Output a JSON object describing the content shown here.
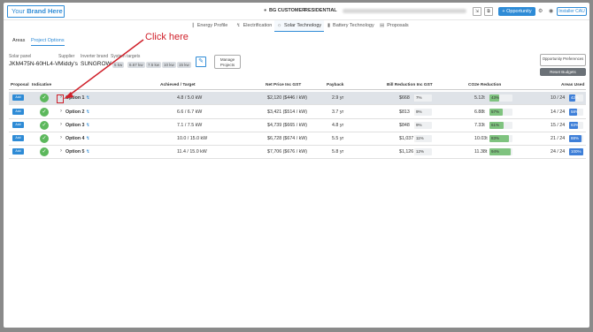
{
  "header": {
    "brand_prefix": "Your ",
    "brand_bold": "Brand Here",
    "user_label": "BG CUSTOMER",
    "mode_label": "RESIDENTIAL",
    "opportunity_button": "+ Opportunity",
    "installer_button": "Installer CAU"
  },
  "main_tabs": [
    {
      "label": "Energy Profile",
      "icon": "chart-icon"
    },
    {
      "label": "Electrification",
      "icon": "bolt-icon"
    },
    {
      "label": "Solar Technology",
      "icon": "sun-icon"
    },
    {
      "label": "Battery Technology",
      "icon": "battery-icon"
    },
    {
      "label": "Proposals",
      "icon": "document-icon"
    }
  ],
  "sub_tabs": [
    {
      "label": "Areas"
    },
    {
      "label": "Project Options"
    }
  ],
  "config": {
    "solar_panel_label": "Solar panel",
    "solar_panel_value": "JKM475N-60HL4-V",
    "supplier_label": "Supplier",
    "supplier_value": "Middy's",
    "inverter_label": "Inverter brand",
    "inverter_value": "SUNGROW",
    "sizes_label": "System targets",
    "sizes": [
      "5 kw",
      "6.67 kw",
      "7.5 kw",
      "10 kw",
      "15 kw"
    ],
    "manage_button": "Manage Projects",
    "opportunity_prefs_button": "Opportunity Preferences",
    "reset_button": "Reset Budgets"
  },
  "table": {
    "headers": {
      "proposal": "Proposal",
      "indicative": "Indicative",
      "achieved": "Achieved / Target",
      "net_price": "Net Price Inc GST",
      "payback": "Payback",
      "bill": "Bill Reduction Inc GST",
      "co2": "CO2e Reduction",
      "areas": "Areas Used"
    },
    "add_label": "Add",
    "rows": [
      {
        "name": "Option 1",
        "achieved": "4.8 / 5.0 kW",
        "net_price": "$2,120 ($446 / kW)",
        "payback": "2.9 yr",
        "bill": "$668",
        "bill_pct": "7%",
        "bill_frac": 0.07,
        "co2": "5.12t",
        "co2_pct": "43%",
        "co2_frac": 0.43,
        "areas": "10 / 24",
        "areas_pct": "42%",
        "areas_frac": 0.42
      },
      {
        "name": "Option 2",
        "achieved": "6.6 / 6.7 kW",
        "net_price": "$3,421 ($514 / kW)",
        "payback": "3.7 yr",
        "bill": "$813",
        "bill_pct": "9%",
        "bill_frac": 0.09,
        "co2": "6.88t",
        "co2_pct": "57%",
        "co2_frac": 0.57,
        "areas": "14 / 24",
        "areas_pct": "58%",
        "areas_frac": 0.58
      },
      {
        "name": "Option 3",
        "achieved": "7.1 / 7.5 kW",
        "net_price": "$4,739 ($665 / kW)",
        "payback": "4.8 yr",
        "bill": "$848",
        "bill_pct": "9%",
        "bill_frac": 0.09,
        "co2": "7.33t",
        "co2_pct": "61%",
        "co2_frac": 0.61,
        "areas": "15 / 24",
        "areas_pct": "63%",
        "areas_frac": 0.63
      },
      {
        "name": "Option 4",
        "achieved": "10.0 / 15.0 kW",
        "net_price": "$6,728 ($674 / kW)",
        "payback": "5.5 yr",
        "bill": "$1,037",
        "bill_pct": "11%",
        "bill_frac": 0.11,
        "co2": "10.03t",
        "co2_pct": "83%",
        "co2_frac": 0.83,
        "areas": "21 / 24",
        "areas_pct": "88%",
        "areas_frac": 0.88
      },
      {
        "name": "Option 5",
        "achieved": "11.4 / 15.0 kW",
        "net_price": "$7,706 ($676 / kW)",
        "payback": "5.8 yr",
        "bill": "$1,126",
        "bill_pct": "12%",
        "bill_frac": 0.12,
        "co2": "11.38t",
        "co2_pct": "94%",
        "co2_frac": 0.94,
        "areas": "24 / 24",
        "areas_pct": "100%",
        "areas_frac": 1.0
      }
    ]
  },
  "annotation": {
    "text": "Click here",
    "color": "#d0202a"
  },
  "colors": {
    "accent": "#2e8bd6",
    "check": "#5cb85c",
    "bill_bar": "#f3f3f3",
    "co2_bar": "#7fc37f",
    "areas_bar": "#3e7fd8"
  }
}
